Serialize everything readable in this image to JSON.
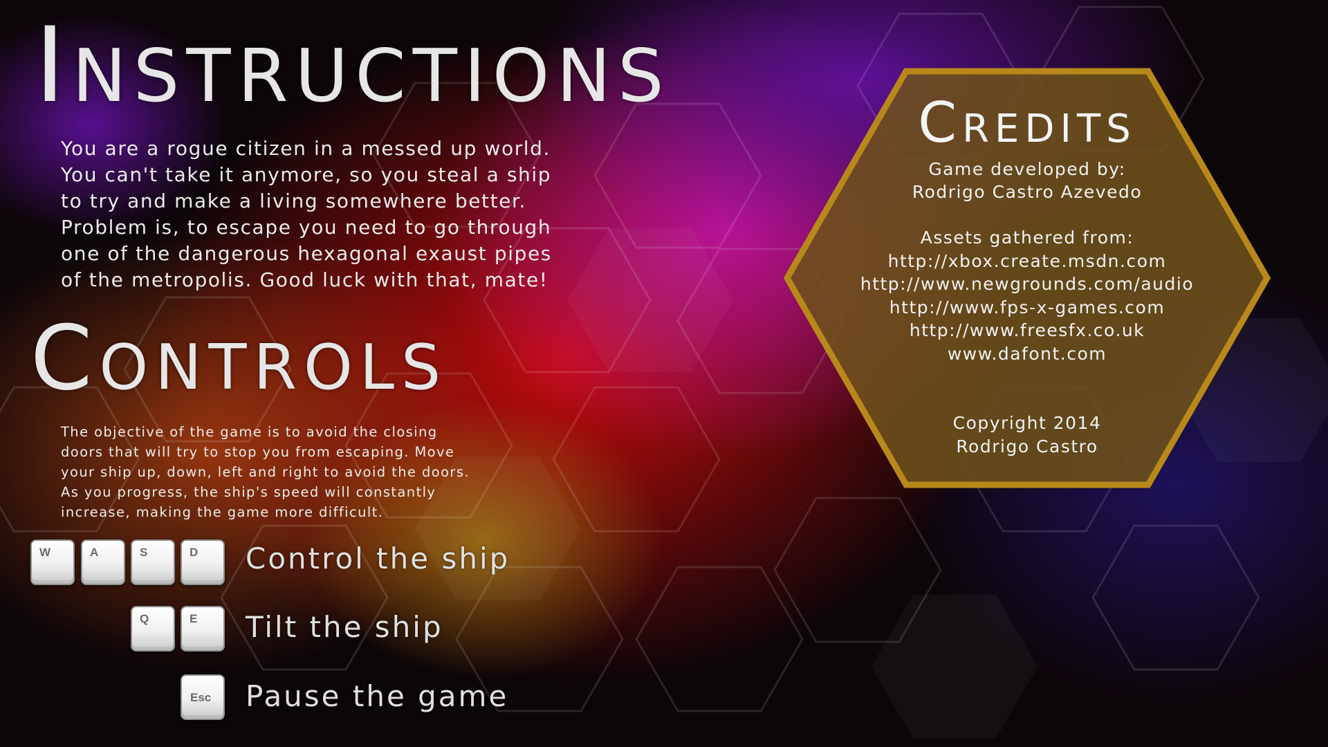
{
  "instructions": {
    "title": "Instructions",
    "story_lines": [
      "You are a rogue citizen in a messed up world.",
      "You can't take it anymore, so you steal a ship",
      "to try and make a living somewhere better.",
      "Problem is, to escape you need to go through",
      "one of the dangerous hexagonal exaust pipes",
      "of the metropolis. Good luck with that, mate!"
    ]
  },
  "controls": {
    "title": "Controls",
    "objective_lines": [
      "The objective of the game is to avoid the closing",
      "doors that will try to stop you from escaping. Move",
      "your ship up, down, left and right to avoid the doors.",
      "As you progress, the ship's speed will constantly",
      "increase, making the game more difficult."
    ],
    "keys": {
      "w": "W",
      "a": "A",
      "s": "S",
      "d": "D",
      "q": "Q",
      "e": "E",
      "esc": "Esc"
    },
    "actions": {
      "move": "Control the ship",
      "tilt": "Tilt the ship",
      "pause": "Pause the game"
    }
  },
  "credits": {
    "title": "Credits",
    "developed_label": "Game developed by:",
    "developer": "Rodrigo Castro Azevedo",
    "assets_label": "Assets gathered from:",
    "asset_sources": [
      "http://xbox.create.msdn.com",
      "http://www.newgrounds.com/audio",
      "http://www.fps-x-games.com",
      "http://www.freesfx.co.uk",
      "www.dafont.com"
    ],
    "copyright_line": "Copyright 2014",
    "copyright_name": "Rodrigo Castro"
  },
  "colors": {
    "hex_fill": "#70521c",
    "hex_border": "#b8891a",
    "text": "#ececec"
  }
}
